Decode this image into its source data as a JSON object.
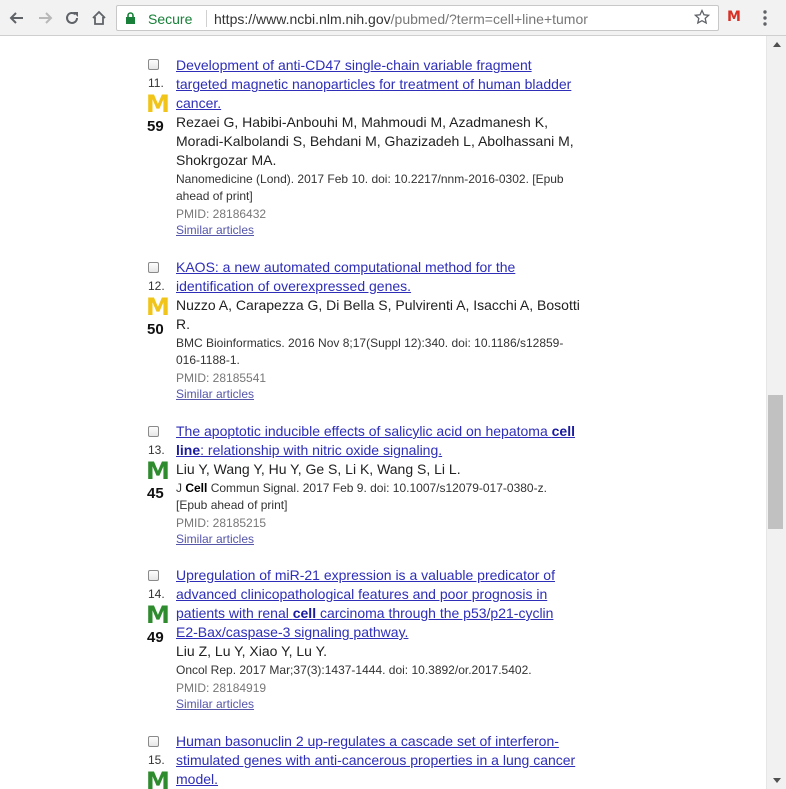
{
  "browser": {
    "secure_label": "Secure",
    "url_host": "https://www.ncbi.nlm.nih.gov",
    "url_path": "/pubmed/?term=cell+line+tumor",
    "ext_letter": "M"
  },
  "results": [
    {
      "index": "11.",
      "altmetric_letter": "M",
      "altmetric_color": "#f0c419",
      "altmetric_score": "59",
      "title": "Development of anti-CD47 single-chain variable fragment targeted magnetic nanoparticles for treatment of human bladder cancer.",
      "authors": "Rezaei G, Habibi-Anbouhi M, Mahmoudi M, Azadmanesh K, Moradi-Kalbolandi S, Behdani M, Ghazizadeh L, Abolhassani M, Shokrgozar MA.",
      "journal": "Nanomedicine (Lond). 2017 Feb 10. doi: 10.2217/nnm-2016-0302. [Epub ahead of print]",
      "pmid": "PMID: 28186432",
      "similar": "Similar articles"
    },
    {
      "index": "12.",
      "altmetric_letter": "M",
      "altmetric_color": "#f0c419",
      "altmetric_score": "50",
      "title": "KAOS: a new automated computational method for the identification of overexpressed genes.",
      "authors": "Nuzzo A, Carapezza G, Di Bella S, Pulvirenti A, Isacchi A, Bosotti R.",
      "journal": "BMC Bioinformatics. 2016 Nov 8;17(Suppl 12):340. doi: 10.1186/s12859-016-1188-1.",
      "pmid": "PMID: 28185541",
      "similar": "Similar articles"
    },
    {
      "index": "13.",
      "altmetric_letter": "M",
      "altmetric_color": "#2e8b2e",
      "altmetric_score": "45",
      "title_pre": "The apoptotic inducible effects of salicylic acid on hepatoma ",
      "title_bold": "cell line",
      "title_post": ": relationship with nitric oxide signaling.",
      "authors": "Liu Y, Wang Y, Hu Y, Ge S, Li K, Wang S, Li L.",
      "journal_pre": "J ",
      "journal_bold": "Cell",
      "journal_post": " Commun Signal. 2017 Feb 9. doi: 10.1007/s12079-017-0380-z. [Epub ahead of print]",
      "pmid": "PMID: 28185215",
      "similar": "Similar articles"
    },
    {
      "index": "14.",
      "altmetric_letter": "M",
      "altmetric_color": "#2e8b2e",
      "altmetric_score": "49",
      "title_pre": "Upregulation of miR-21 expression is a valuable predicator of advanced clinicopathological features and poor prognosis in patients with renal ",
      "title_bold": "cell",
      "title_post": " carcinoma through the p53/p21-cyclin E2-Bax/caspase-3 signaling pathway.",
      "authors": "Liu Z, Lu Y, Xiao Y, Lu Y.",
      "journal": "Oncol Rep. 2017 Mar;37(3):1437-1444. doi: 10.3892/or.2017.5402.",
      "pmid": "PMID: 28184919",
      "similar": "Similar articles"
    },
    {
      "index": "15.",
      "altmetric_letter": "M",
      "altmetric_color": "#2e8b2e",
      "title": "Human basonuclin 2 up-regulates a cascade set of interferon-stimulated genes with anti-cancerous properties in a lung cancer model."
    }
  ]
}
